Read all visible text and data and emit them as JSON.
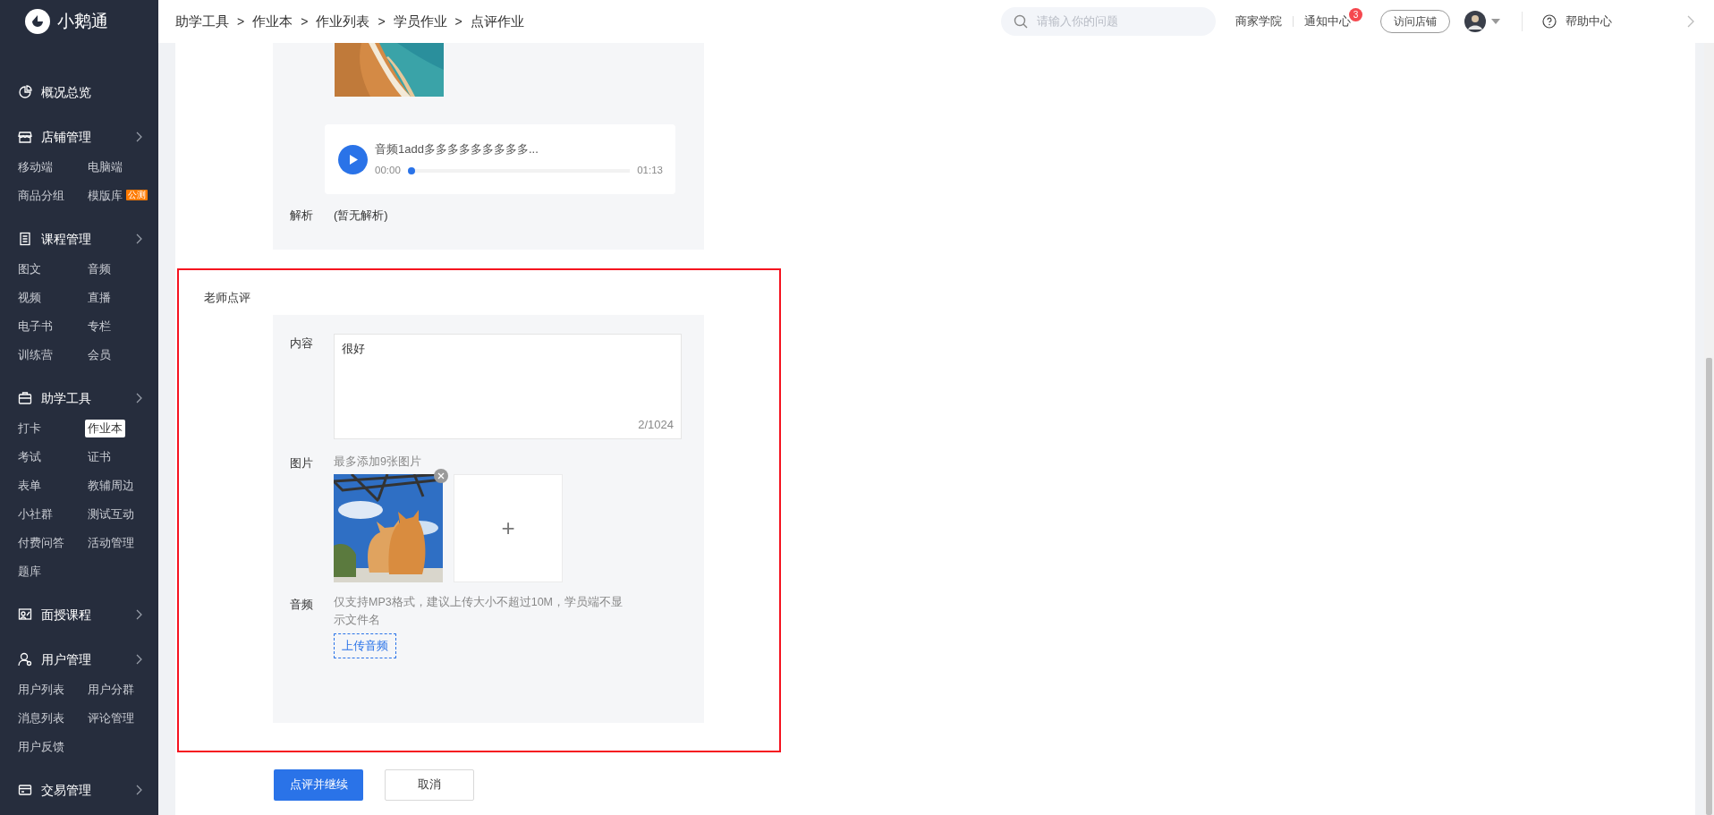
{
  "sidebar": {
    "logo": "小鹅通",
    "groups": [
      {
        "label": "概况总览",
        "expandable": false
      },
      {
        "label": "店铺管理",
        "expandable": true,
        "items": [
          {
            "label": "移动端",
            "selected": false
          },
          {
            "label": "电脑端",
            "selected": false
          },
          {
            "label": "商品分组",
            "selected": false
          },
          {
            "label": "模版库",
            "selected": false,
            "badge": "公测"
          }
        ]
      },
      {
        "label": "课程管理",
        "expandable": true,
        "items": [
          {
            "label": "图文",
            "selected": false
          },
          {
            "label": "音频",
            "selected": false
          },
          {
            "label": "视频",
            "selected": false
          },
          {
            "label": "直播",
            "selected": false
          },
          {
            "label": "电子书",
            "selected": false
          },
          {
            "label": "专栏",
            "selected": false
          },
          {
            "label": "训练营",
            "selected": false
          },
          {
            "label": "会员",
            "selected": false
          }
        ]
      },
      {
        "label": "助学工具",
        "expandable": true,
        "items": [
          {
            "label": "打卡",
            "selected": false
          },
          {
            "label": "作业本",
            "selected": true
          },
          {
            "label": "考试",
            "selected": false
          },
          {
            "label": "证书",
            "selected": false
          },
          {
            "label": "表单",
            "selected": false
          },
          {
            "label": "教辅周边",
            "selected": false
          },
          {
            "label": "小社群",
            "selected": false
          },
          {
            "label": "测试互动",
            "selected": false
          },
          {
            "label": "付费问答",
            "selected": false
          },
          {
            "label": "活动管理",
            "selected": false
          },
          {
            "label": "题库",
            "selected": false
          }
        ]
      },
      {
        "label": "面授课程",
        "expandable": true
      },
      {
        "label": "用户管理",
        "expandable": true,
        "items": [
          {
            "label": "用户列表",
            "selected": false
          },
          {
            "label": "用户分群",
            "selected": false
          },
          {
            "label": "消息列表",
            "selected": false
          },
          {
            "label": "评论管理",
            "selected": false
          },
          {
            "label": "用户反馈",
            "selected": false
          }
        ]
      },
      {
        "label": "交易管理",
        "expandable": true
      }
    ]
  },
  "header": {
    "breadcrumb": [
      {
        "kind": "crumb",
        "label": "助学工具"
      },
      {
        "kind": "separator",
        "label": ">"
      },
      {
        "kind": "crumb",
        "label": "作业本"
      },
      {
        "kind": "separator",
        "label": ">"
      },
      {
        "kind": "crumb",
        "label": "作业列表"
      },
      {
        "kind": "separator",
        "label": ">"
      },
      {
        "kind": "crumb",
        "label": "学员作业"
      },
      {
        "kind": "separator",
        "label": ">"
      },
      {
        "kind": "crumb",
        "label": "点评作业"
      }
    ],
    "search": {
      "placeholder": "请输入你的问题"
    },
    "links": [
      {
        "label": "商家学院"
      },
      {
        "label": "通知中心",
        "badge": "3"
      }
    ],
    "visit_button": "访问店铺",
    "help": "帮助中心"
  },
  "answer": {
    "audio": {
      "title": "音频1add多多多多多多多多多...",
      "current": "00:00",
      "duration": "01:13",
      "level": 0
    },
    "analysis": {
      "label": "解析",
      "value": "(暂无解析)"
    }
  },
  "review": {
    "highlighted": true,
    "title": "老师点评",
    "content": {
      "label": "内容",
      "value": "很好",
      "counter": "2/1024"
    },
    "images": {
      "label": "图片",
      "hint": "最多添加9张图片",
      "add": "+"
    },
    "audio": {
      "label": "音频",
      "hint": "仅支持MP3格式，建议上传大小不超过10M，学员端不显示文件名",
      "upload": "上传音频"
    }
  },
  "actions": [
    {
      "label": "点评并继续",
      "kind": "primary"
    },
    {
      "label": "取消",
      "kind": "secondary"
    }
  ]
}
